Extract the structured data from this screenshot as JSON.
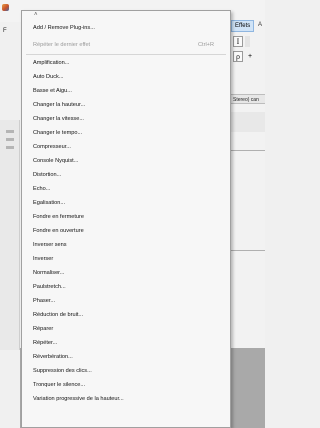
{
  "background": {
    "left_menu_letter": "F",
    "menubar_effects": "Effets",
    "menubar_more": "A",
    "toolbar_glyphs": [
      "I",
      "ρ",
      "+"
    ],
    "track_label": "Stereo) can"
  },
  "menu": {
    "scroll_up": "˄",
    "top_items": [
      {
        "label": "Add / Remove Plug-ins...",
        "shortcut": "",
        "disabled": false
      },
      {
        "label": "Répéter le dernier effet",
        "shortcut": "Ctrl+R",
        "disabled": true
      }
    ],
    "effects": [
      "Amplification...",
      "Auto Duck...",
      "Basse et Aigu...",
      "Changer la hauteur...",
      "Changer la vitesse...",
      "Changer le tempo...",
      "Compresseur...",
      "Console Nyquist...",
      "Distortion...",
      "Echo...",
      "Egalisation...",
      "Fondre en fermeture",
      "Fondre en ouverture",
      "Inverser sens",
      "Inverser",
      "Normaliser...",
      "Paulstretch...",
      "Phaser...",
      "Réduction de bruit...",
      "Réparer",
      "Répéter...",
      "Réverbération...",
      "Suppression des clics...",
      "Tronquer le silence...",
      "Variation progressive de la hauteur..."
    ]
  }
}
